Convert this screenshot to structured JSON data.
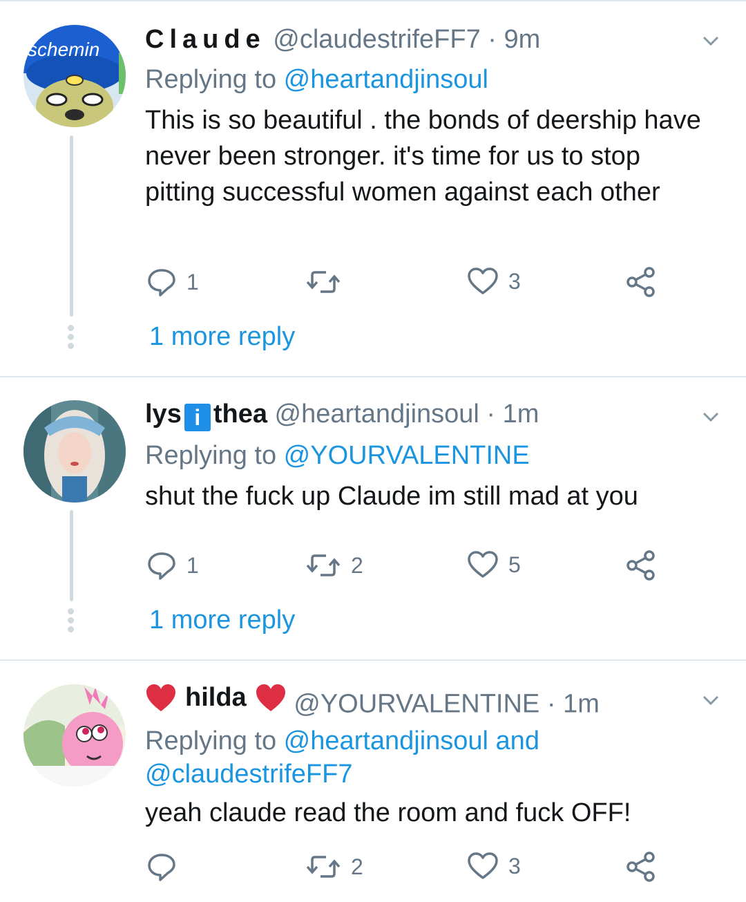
{
  "tweets": [
    {
      "name": "Claude",
      "handle": "@claudestrifeFF7",
      "time": "· 9m",
      "replying_prefix": "Replying to ",
      "replying_to": "@heartandjinsoul",
      "text": "This is so beautiful . the bonds of deership have never been stronger. it's time for us to stop pitting successful women against each other",
      "replies": "1",
      "retweets": "",
      "likes": "3",
      "more": "1 more reply",
      "avatar_text": "schemin"
    },
    {
      "name_a": "lys",
      "name_badge": "i",
      "name_b": "thea",
      "handle": "@heartandjinsoul",
      "time": "· 1m",
      "replying_prefix": "Replying to ",
      "replying_to": "@YOURVALENTINE",
      "text": "shut the fuck up Claude im still mad at you",
      "replies": "1",
      "retweets": "2",
      "likes": "5",
      "more": "1 more reply"
    },
    {
      "name": "hilda",
      "handle": "@YOURVALENTINE",
      "time": "· 1m",
      "replying_prefix": "Replying to ",
      "replying_to": "@heartandjinsoul and",
      "replying_to_2": "@claudestrifeFF7",
      "text": "yeah claude read the room and fuck OFF!",
      "replies": "",
      "retweets": "2",
      "likes": "3"
    }
  ],
  "colors": {
    "link": "#1b95e0",
    "muted": "#657786",
    "text": "#14171a",
    "heart": "#e0243b"
  }
}
